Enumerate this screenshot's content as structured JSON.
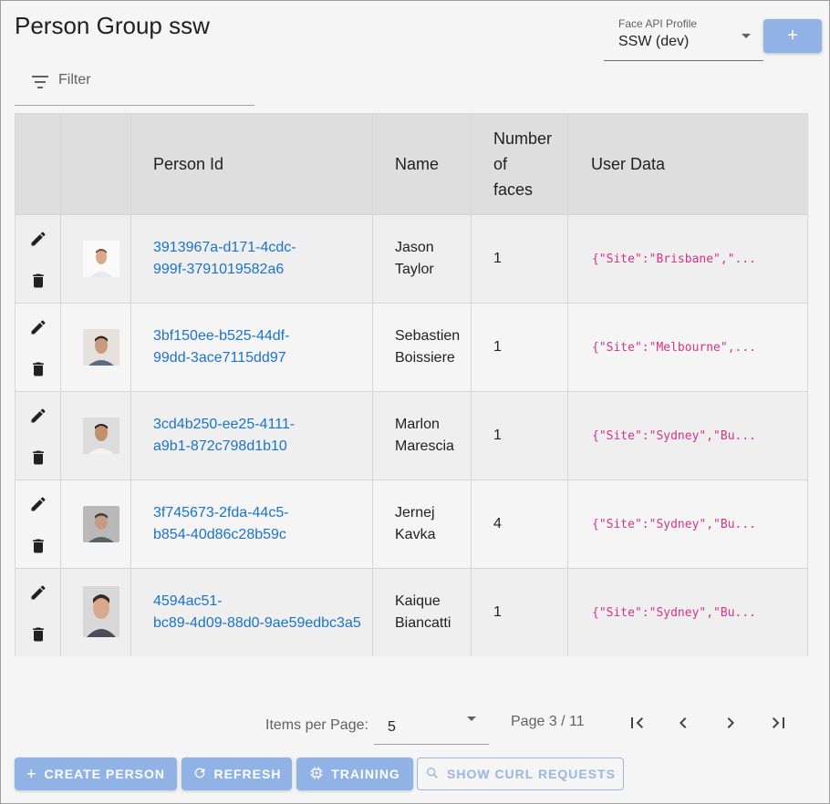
{
  "header": {
    "title": "Person Group ssw",
    "profile_label": "Face API Profile",
    "profile_value": "SSW (dev)",
    "add_label": "+"
  },
  "filter": {
    "label": "Filter"
  },
  "table": {
    "columns": [
      "",
      "",
      "Person Id",
      "Name",
      "Number of faces",
      "User Data"
    ],
    "col_faces_lines": [
      "Number",
      "of",
      "faces"
    ],
    "rows": [
      {
        "id_line1": "3913967a-d171-4cdc-",
        "id_line2": "999f-3791019582a6",
        "name_line1": "Jason",
        "name_line2": "Taylor",
        "faces": "1",
        "user_data": "{\"Site\":\"Brisbane\",\"..."
      },
      {
        "id_line1": "3bf150ee-b525-44df-",
        "id_line2": "99dd-3ace7115dd97",
        "name_line1": "Sebastien",
        "name_line2": "Boissiere",
        "faces": "1",
        "user_data": "{\"Site\":\"Melbourne\",..."
      },
      {
        "id_line1": "3cd4b250-ee25-4111-",
        "id_line2": "a9b1-872c798d1b10",
        "name_line1": "Marlon",
        "name_line2": "Marescia",
        "faces": "1",
        "user_data": "{\"Site\":\"Sydney\",\"Bu..."
      },
      {
        "id_line1": "3f745673-2fda-44c5-",
        "id_line2": "b854-40d86c28b59c",
        "name_line1": "Jernej",
        "name_line2": "Kavka",
        "faces": "4",
        "user_data": "{\"Site\":\"Sydney\",\"Bu..."
      },
      {
        "id_line1": "4594ac51-",
        "id_line2": "bc89-4d09-88d0-9ae59edbc3a5",
        "name_line1": "Kaique",
        "name_line2": "Biancatti",
        "faces": "1",
        "user_data": "{\"Site\":\"Sydney\",\"Bu..."
      }
    ]
  },
  "pagination": {
    "items_per_page_label": "Items per Page:",
    "items_per_page_value": "5",
    "page_indicator": "Page 3 / 11"
  },
  "actions": {
    "create": "CREATE PERSON",
    "refresh": "REFRESH",
    "training": "TRAINING",
    "curl": "SHOW CURL REQUESTS"
  },
  "colors": {
    "primary": "#90b2e4",
    "link": "#1a73c9",
    "code": "#d63384"
  }
}
